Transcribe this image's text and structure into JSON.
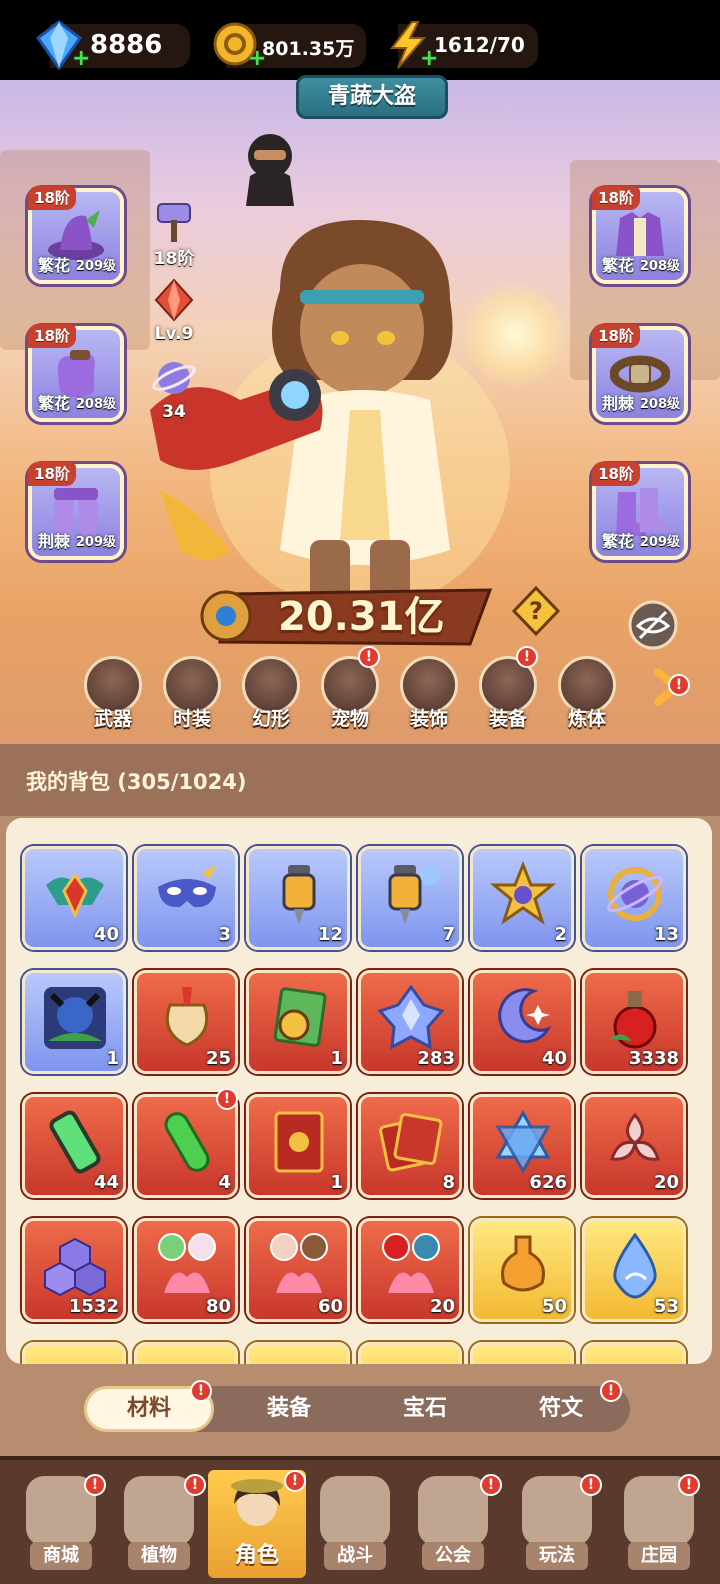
{
  "resources": {
    "diamonds": "8886",
    "gold": "801.35万",
    "energy": "1612/70"
  },
  "character": {
    "title": "青蔬大盗",
    "power": "20.31亿"
  },
  "equipment_left": [
    {
      "tier": "18阶",
      "quality": "繁花",
      "level": "209级"
    },
    {
      "tier": "18阶",
      "quality": "繁花",
      "level": "208级"
    },
    {
      "tier": "18阶",
      "quality": "荆棘",
      "level": "209级"
    }
  ],
  "equipment_right": [
    {
      "tier": "18阶",
      "quality": "繁花",
      "level": "208级"
    },
    {
      "tier": "18阶",
      "quality": "荆棘",
      "level": "208级"
    },
    {
      "tier": "18阶",
      "quality": "繁花",
      "level": "209级"
    }
  ],
  "middle_stats": {
    "weapon_tier": "18阶",
    "gem_level": "Lv.9",
    "orb_count": "34"
  },
  "function_buttons": [
    {
      "label": "武器",
      "alert": false
    },
    {
      "label": "时装",
      "alert": false
    },
    {
      "label": "幻形",
      "alert": false
    },
    {
      "label": "宠物",
      "alert": true
    },
    {
      "label": "装饰",
      "alert": false
    },
    {
      "label": "装备",
      "alert": true
    },
    {
      "label": "炼体",
      "alert": false
    }
  ],
  "bag": {
    "title": "我的背包 (305/1024)",
    "items": [
      {
        "icon": "scarab-icon",
        "count": "40",
        "color": "blue"
      },
      {
        "icon": "mask-icon",
        "count": "3",
        "color": "blue"
      },
      {
        "icon": "vial-icon",
        "count": "12",
        "color": "blue"
      },
      {
        "icon": "vial-cloud-icon",
        "count": "7",
        "color": "blue"
      },
      {
        "icon": "star-icon",
        "count": "2",
        "color": "blue"
      },
      {
        "icon": "ring-orb-icon",
        "count": "13",
        "color": "blue"
      },
      {
        "icon": "monster-portrait-icon",
        "count": "1",
        "color": "blue"
      },
      {
        "icon": "potion-bag-icon",
        "count": "25",
        "color": "red"
      },
      {
        "icon": "clock-book-icon",
        "count": "1",
        "color": "red"
      },
      {
        "icon": "crystal-icon",
        "count": "283",
        "color": "red"
      },
      {
        "icon": "moon-icon",
        "count": "40",
        "color": "red"
      },
      {
        "icon": "red-potion-icon",
        "count": "3338",
        "color": "red"
      },
      {
        "icon": "green-tube-icon",
        "count": "44",
        "color": "red"
      },
      {
        "icon": "green-capsule-icon",
        "count": "4",
        "color": "red",
        "alert": true
      },
      {
        "icon": "red-book-icon",
        "count": "1",
        "color": "red"
      },
      {
        "icon": "card-pack-icon",
        "count": "8",
        "color": "red"
      },
      {
        "icon": "hexagram-icon",
        "count": "626",
        "color": "red"
      },
      {
        "icon": "knot-icon",
        "count": "20",
        "color": "red"
      },
      {
        "icon": "hex-crystals-icon",
        "count": "1532",
        "color": "red"
      },
      {
        "icon": "lotus-duo-icon",
        "count": "80",
        "color": "red"
      },
      {
        "icon": "lotus-duo-icon",
        "count": "60",
        "color": "red"
      },
      {
        "icon": "lotus-duo-icon",
        "count": "20",
        "color": "red"
      },
      {
        "icon": "gold-flask-icon",
        "count": "50",
        "color": "gold"
      },
      {
        "icon": "water-drop-icon",
        "count": "53",
        "color": "gold"
      }
    ]
  },
  "bag_tabs": [
    {
      "label": "材料",
      "alert": true,
      "active": true
    },
    {
      "label": "装备",
      "alert": false,
      "active": false
    },
    {
      "label": "宝石",
      "alert": false,
      "active": false
    },
    {
      "label": "符文",
      "alert": true,
      "active": false
    }
  ],
  "bottom_nav": [
    {
      "label": "商城",
      "alert": true,
      "active": false
    },
    {
      "label": "植物",
      "alert": true,
      "active": false
    },
    {
      "label": "角色",
      "alert": true,
      "active": true
    },
    {
      "label": "战斗",
      "alert": false,
      "active": false
    },
    {
      "label": "公会",
      "alert": true,
      "active": false
    },
    {
      "label": "玩法",
      "alert": true,
      "active": false
    },
    {
      "label": "庄园",
      "alert": true,
      "active": false
    }
  ],
  "colors": {
    "slot_blue": "#8d82e0",
    "cell_red": "#c8372b",
    "cell_gold": "#f3b932",
    "alert_red": "#e23b2e",
    "nav_active": "#ffcb4e"
  }
}
